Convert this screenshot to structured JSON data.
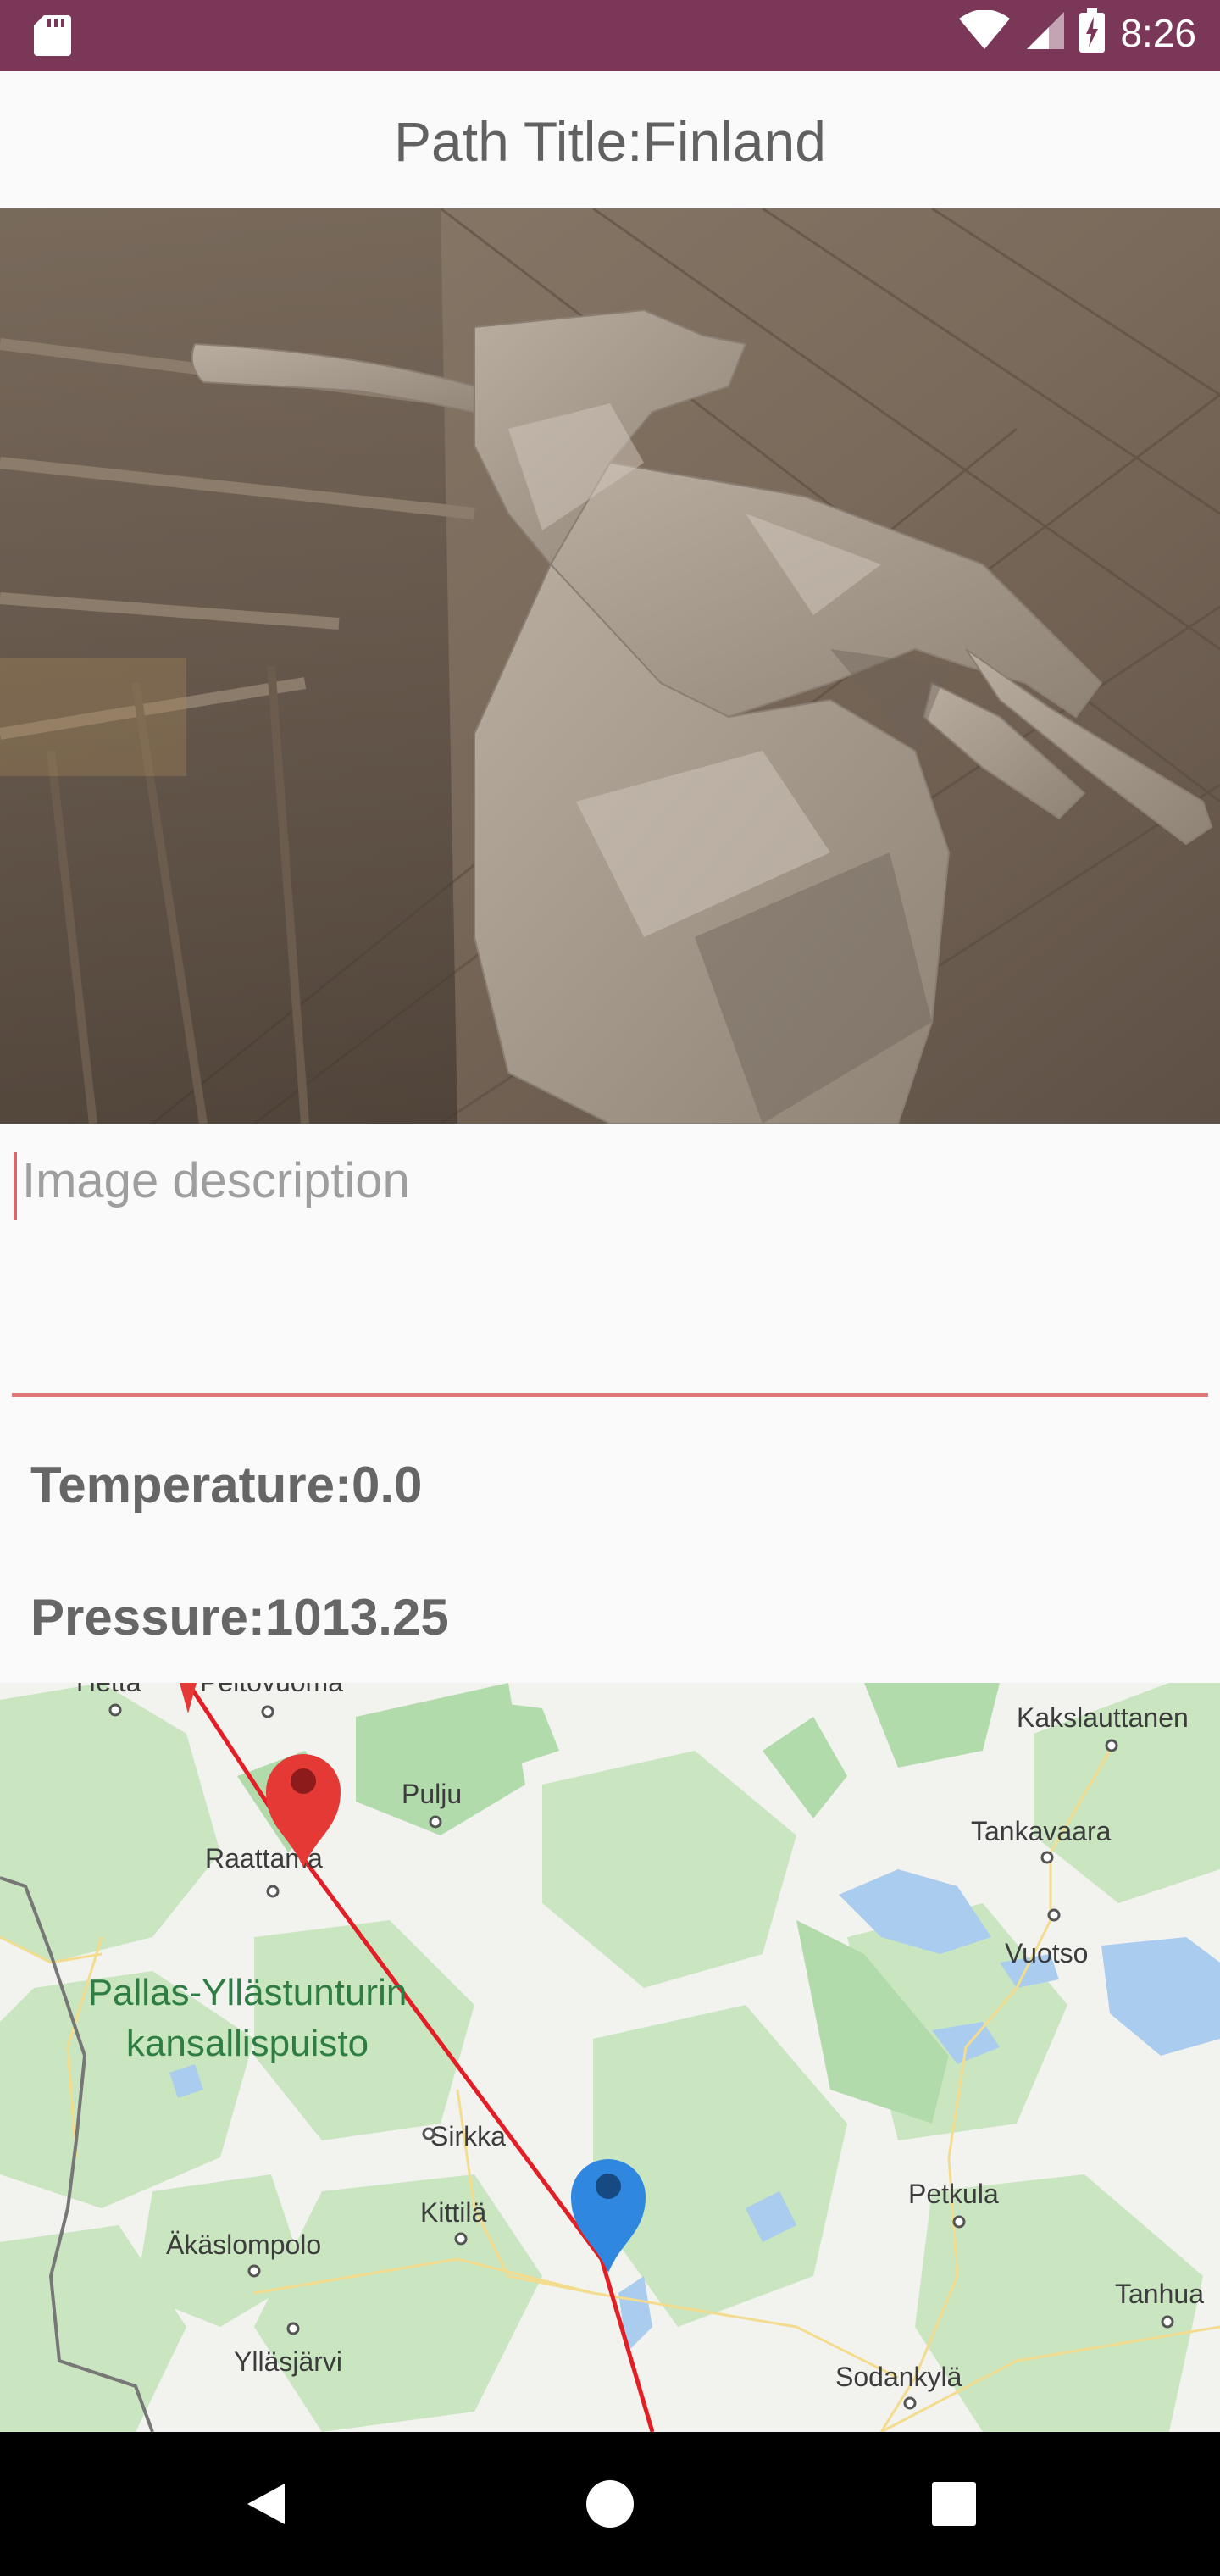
{
  "status_bar": {
    "time": "8:26",
    "icons": [
      "sd-card-icon",
      "wifi-icon",
      "signal-icon",
      "battery-icon"
    ]
  },
  "header": {
    "title": "Path Title:Finland"
  },
  "photo": {
    "subject": "low-poly-dog-3d-render"
  },
  "description": {
    "placeholder": "Image description",
    "value": "",
    "accent_color": "#e07777"
  },
  "info": {
    "temperature": "Temperature:0.0",
    "pressure": "Pressure:1013.25"
  },
  "map": {
    "labels": {
      "hetta": "Hetta",
      "peltovuoma": "Peltovuoma",
      "pulju": "Pulju",
      "raattama": "Raattama",
      "kakslauttanen": "Kakslauttanen",
      "tankavaara": "Tankavaara",
      "vuotso": "Vuotso",
      "park_line1": "Pallas-Yllästunturin",
      "park_line2": "kansallispuisto",
      "sirkka": "Sirkka",
      "kittila": "Kittilä",
      "akaslompolo": "Äkäslompolo",
      "petkula": "Petkula",
      "tanhua": "Tanhua",
      "yllasjarvi": "Ylläsjärvi",
      "sodankyla": "Sodankylä"
    },
    "route_color": "#e31e24",
    "start_marker_color": "#e53935",
    "end_marker_color": "#2f87df"
  },
  "nav": {
    "buttons": [
      "back-icon",
      "home-icon",
      "recents-icon"
    ]
  }
}
